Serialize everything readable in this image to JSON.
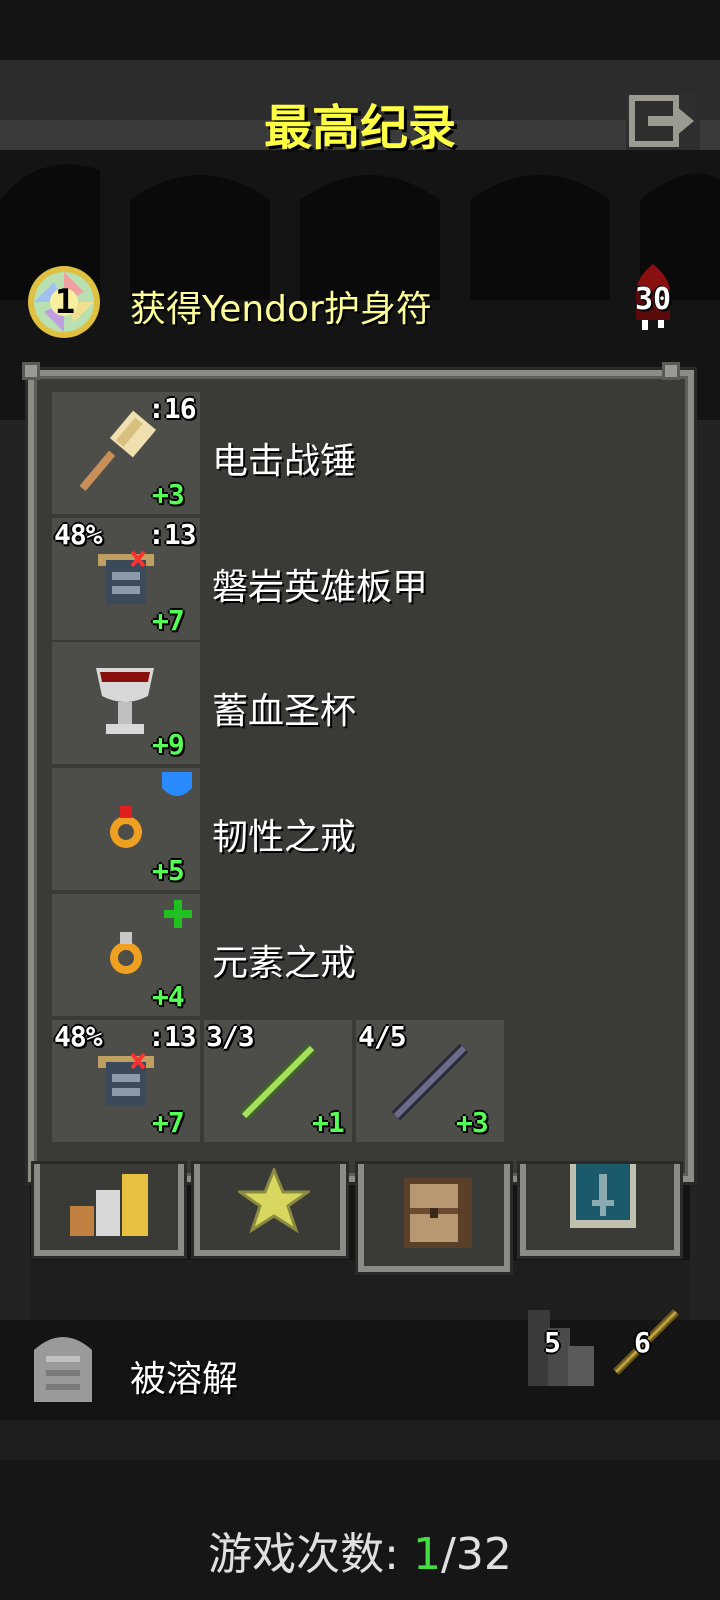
{
  "header": {
    "title": "最高纪录",
    "exit_icon": "exit-icon"
  },
  "result": {
    "amulet_icon": "yendor-amulet-icon",
    "amulet_number": "1",
    "text": "获得Yendor护身符",
    "depth_icon": "blood-depth-icon",
    "depth": "30"
  },
  "items": [
    {
      "name": "电击战锤",
      "icon": "war-hammer-icon",
      "tier_label": ":16",
      "level": "+3",
      "durability": ""
    },
    {
      "name": "磐岩英雄板甲",
      "icon": "plate-armor-icon",
      "tier_label": ":13",
      "level": "+7",
      "durability": "48%"
    },
    {
      "name": "蓄血圣杯",
      "icon": "chalice-icon",
      "tier_label": "",
      "level": "+9",
      "durability": ""
    },
    {
      "name": "韧性之戒",
      "icon": "ring-icon",
      "tier_label": "",
      "level": "+5",
      "durability": "",
      "badge": "shield-badge-icon"
    },
    {
      "name": "元素之戒",
      "icon": "ring-icon",
      "tier_label": "",
      "level": "+4",
      "durability": "",
      "badge": "green-plus-badge-icon"
    }
  ],
  "quickslots": [
    {
      "icon": "plate-armor-icon",
      "durability": "48%",
      "tier_label": ":13",
      "level": "+7"
    },
    {
      "icon": "green-wand-icon",
      "charges": "3/3",
      "level": "+1"
    },
    {
      "icon": "purple-wand-icon",
      "charges": "4/5",
      "level": "+3"
    }
  ],
  "tabs": [
    {
      "icon": "stats-bars-icon",
      "selected": false
    },
    {
      "icon": "badges-star-icon",
      "selected": false
    },
    {
      "icon": "backpack-icon",
      "selected": true
    },
    {
      "icon": "journal-sword-icon",
      "selected": false
    }
  ],
  "death": {
    "icon": "tombstone-icon",
    "text": "被溶解"
  },
  "stats": [
    {
      "icon": "strength-stairs-icon",
      "value": "5"
    },
    {
      "icon": "wand-count-icon",
      "value": "6"
    }
  ],
  "games": {
    "label": "游戏次数:",
    "current": "1",
    "total": "/32"
  },
  "colors": {
    "title": "#ffff44",
    "result_text": "#ffff99",
    "level_text": "#55ff55",
    "panel_bg": "#3a3a36",
    "slot_bg": "#4d4d49",
    "border": "#8c8c86"
  }
}
